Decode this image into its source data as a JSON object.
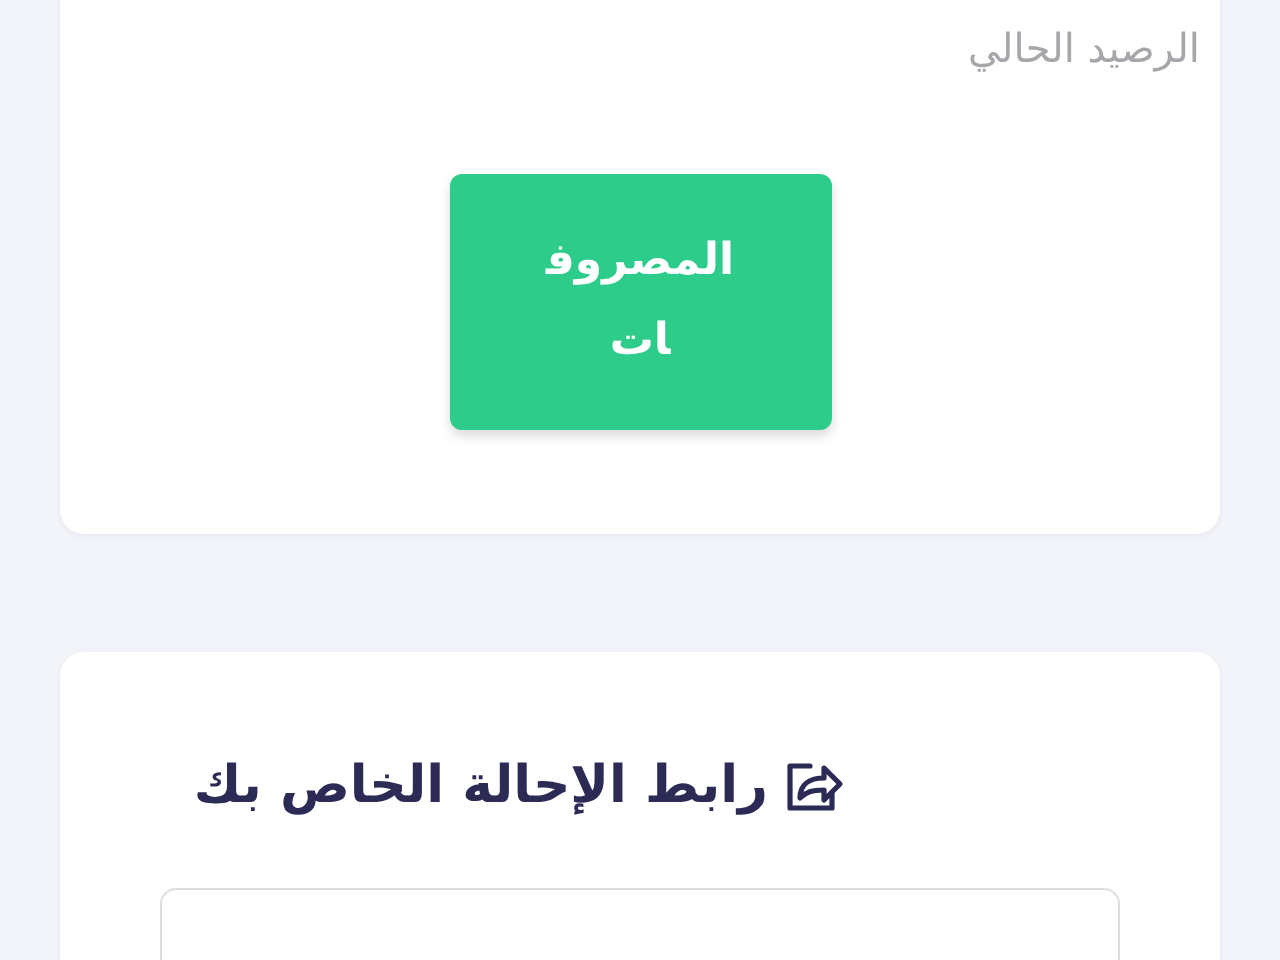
{
  "balance_card": {
    "label": "الرصيد الحالي",
    "button": "المصروفات"
  },
  "referral_card": {
    "title": "رابط الإحالة الخاص بك"
  }
}
